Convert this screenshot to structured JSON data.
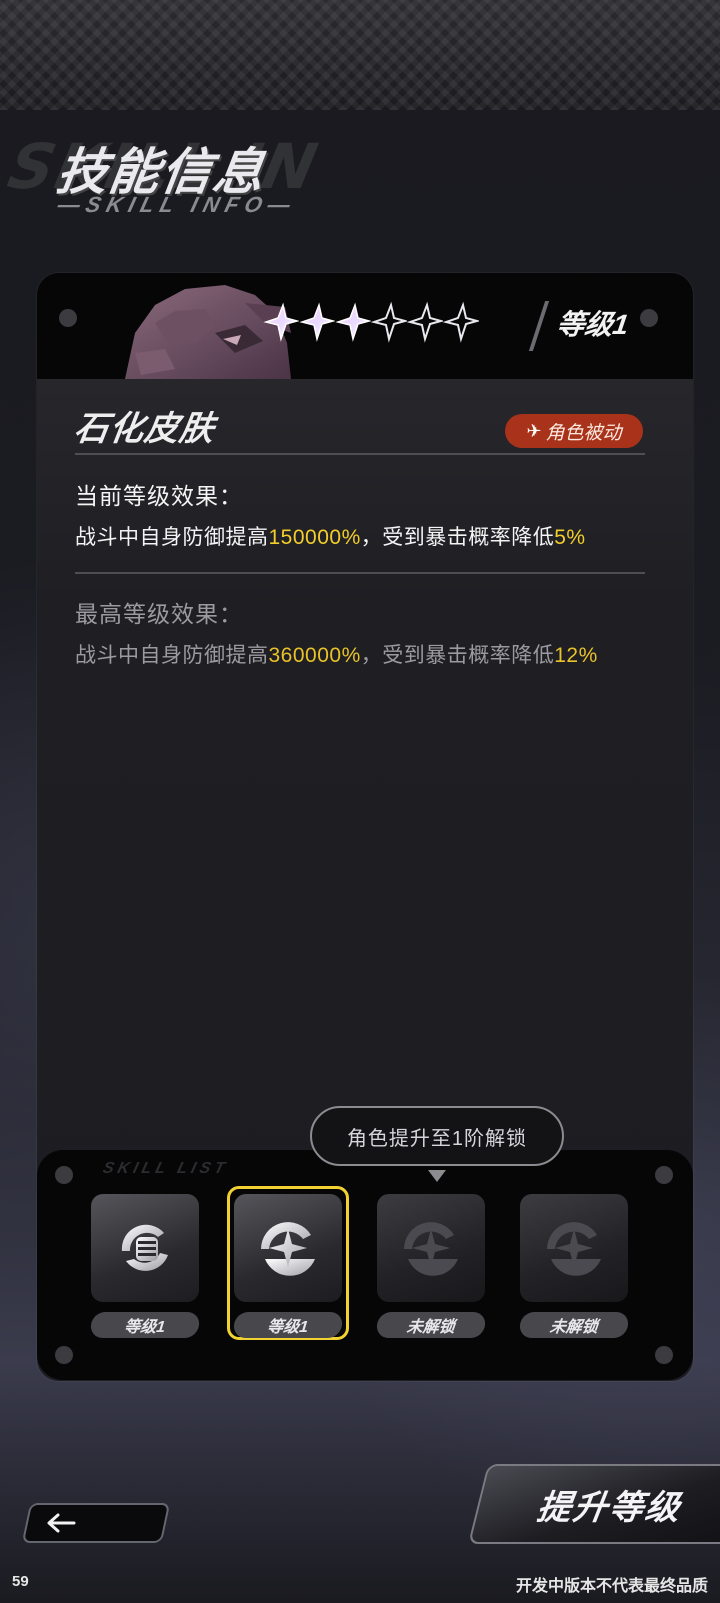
{
  "header": {
    "title": "技能信息",
    "subtitle": "—SKILL INFO—"
  },
  "skill_card": {
    "stars_filled": 3,
    "stars_total": 6,
    "level": "等级1",
    "skill_name": "石化皮肤",
    "type_badge": "角色被动",
    "current_effect": {
      "label": "当前等级效果：",
      "text_before": "战斗中自身防御提高",
      "value1": "150000%",
      "text_middle": "，受到暴击概率降低",
      "value2": "5%"
    },
    "max_effect": {
      "label": "最高等级效果：",
      "text_before": "战斗中自身防御提高",
      "value1": "360000%",
      "text_middle": "，受到暴击概率降低",
      "value2": "12%"
    }
  },
  "unlock_tip": "角色提升至1阶解锁",
  "skill_slots": [
    {
      "label": "等级1",
      "icon": "fist-icon",
      "locked": false,
      "selected": false
    },
    {
      "label": "等级1",
      "icon": "shield-star-icon",
      "locked": false,
      "selected": true
    },
    {
      "label": "未解锁",
      "icon": "shield-star-icon",
      "locked": true,
      "selected": false
    },
    {
      "label": "未解锁",
      "icon": "shield-star-icon",
      "locked": true,
      "selected": false
    }
  ],
  "buttons": {
    "upgrade": "提升等级",
    "back_icon": "arrow-left-icon"
  },
  "footer": {
    "fps": "59",
    "disclaimer": "开发中版本不代表最终品质"
  },
  "colors": {
    "highlight": "#f2cd2b",
    "badge": "#a8331a",
    "selected_frame": "#f2d232"
  }
}
